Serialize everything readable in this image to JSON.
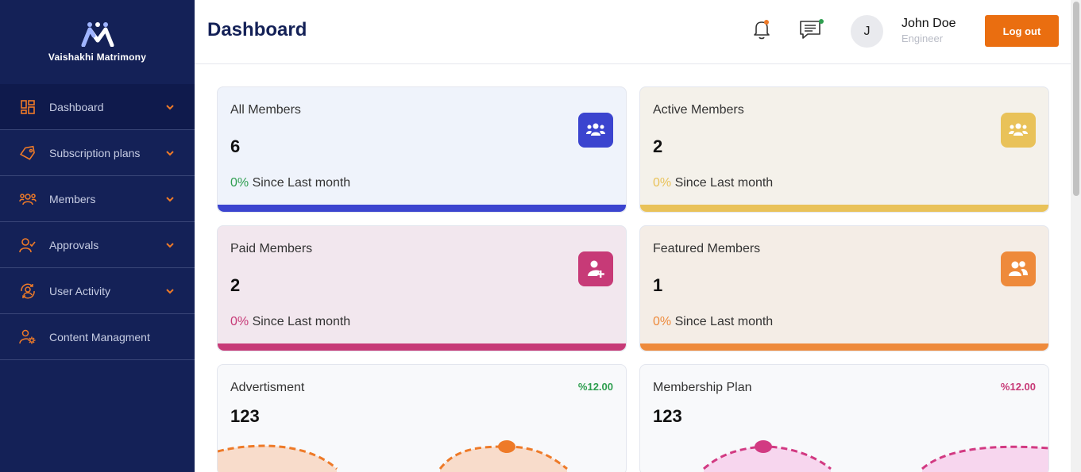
{
  "brand": {
    "name": "Vaishakhi Matrimony"
  },
  "sidebar": {
    "items": [
      {
        "label": "Dashboard",
        "icon": "grid-icon",
        "has_chevron": true
      },
      {
        "label": "Subscription plans",
        "icon": "tag-icon",
        "has_chevron": true
      },
      {
        "label": "Members",
        "icon": "users-icon",
        "has_chevron": true
      },
      {
        "label": "Approvals",
        "icon": "user-check-icon",
        "has_chevron": true
      },
      {
        "label": "User Activity",
        "icon": "user-sync-icon",
        "has_chevron": true
      },
      {
        "label": "Content Managment",
        "icon": "user-gear-icon",
        "has_chevron": false
      }
    ]
  },
  "header": {
    "title": "Dashboard",
    "user": {
      "initial": "J",
      "name": "John Doe",
      "role": "Engineer"
    },
    "logout_label": "Log out"
  },
  "cards": [
    {
      "title": "All Members",
      "value": "6",
      "percent": "0%",
      "since": "Since Last month",
      "accent": "#3b44cf",
      "bg": "#eff3fb",
      "pct_color": "#2e9e4f",
      "icon": "users-group-icon"
    },
    {
      "title": "Active Members",
      "value": "2",
      "percent": "0%",
      "since": "Since Last month",
      "accent": "#e9c259",
      "bg": "#f4f1ea",
      "pct_color": "#e9c259",
      "icon": "users-group-icon"
    },
    {
      "title": "Paid Members",
      "value": "2",
      "percent": "0%",
      "since": "Since Last month",
      "accent": "#c73a77",
      "bg": "#f2e7ee",
      "pct_color": "#c73a77",
      "icon": "user-plus-icon"
    },
    {
      "title": "Featured Members",
      "value": "1",
      "percent": "0%",
      "since": "Since Last month",
      "accent": "#ee8a3b",
      "bg": "#f4ede6",
      "pct_color": "#ee8a3b",
      "icon": "users-pair-icon"
    }
  ],
  "stats": [
    {
      "title": "Advertisment",
      "value": "123",
      "percent": "%12.00",
      "pct_color": "#2e9e4f",
      "wave_color": "#ee7a28",
      "wave_fill": "#f8dccb"
    },
    {
      "title": "Membership Plan",
      "value": "123",
      "percent": "%12.00",
      "pct_color": "#c73a77",
      "wave_color": "#d23a82",
      "wave_fill": "#f7d6ee"
    }
  ]
}
